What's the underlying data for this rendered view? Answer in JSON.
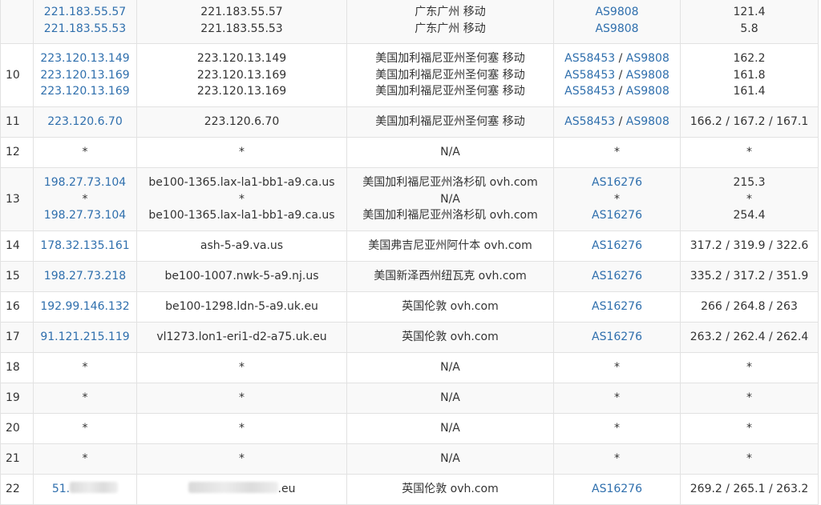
{
  "table": {
    "link_color": "#2f6fad",
    "rows": [
      {
        "hop": "",
        "ips": [
          "221.183.55.57",
          "221.183.55.53"
        ],
        "hosts": [
          "221.183.55.57",
          "221.183.55.53"
        ],
        "locs": [
          "广东广州 移动",
          "广东广州 移动"
        ],
        "asns": [
          [
            "AS9808"
          ],
          [
            "AS9808"
          ]
        ],
        "times": [
          "121.4",
          "5.8"
        ]
      },
      {
        "hop": "10",
        "ips": [
          "223.120.13.149",
          "223.120.13.169",
          "223.120.13.169"
        ],
        "hosts": [
          "223.120.13.149",
          "223.120.13.169",
          "223.120.13.169"
        ],
        "locs": [
          "美国加利福尼亚州圣何塞 移动",
          "美国加利福尼亚州圣何塞 移动",
          "美国加利福尼亚州圣何塞 移动"
        ],
        "asns": [
          [
            "AS58453",
            "AS9808"
          ],
          [
            "AS58453",
            "AS9808"
          ],
          [
            "AS58453",
            "AS9808"
          ]
        ],
        "times": [
          "162.2",
          "161.8",
          "161.4"
        ]
      },
      {
        "hop": "11",
        "ips": [
          "223.120.6.70"
        ],
        "hosts": [
          "223.120.6.70"
        ],
        "locs": [
          "美国加利福尼亚州圣何塞 移动"
        ],
        "asns": [
          [
            "AS58453",
            "AS9808"
          ]
        ],
        "times": [
          "166.2 / 167.2 / 167.1"
        ]
      },
      {
        "hop": "12",
        "ips": [
          "*"
        ],
        "hosts": [
          "*"
        ],
        "locs": [
          "N/A"
        ],
        "asns": [
          [
            "*"
          ]
        ],
        "times": [
          "*"
        ]
      },
      {
        "hop": "13",
        "ips": [
          "198.27.73.104",
          "*",
          "198.27.73.104"
        ],
        "hosts": [
          "be100-1365.lax-la1-bb1-a9.ca.us",
          "*",
          "be100-1365.lax-la1-bb1-a9.ca.us"
        ],
        "locs": [
          "美国加利福尼亚州洛杉矶 ovh.com",
          "N/A",
          "美国加利福尼亚州洛杉矶 ovh.com"
        ],
        "asns": [
          [
            "AS16276"
          ],
          [
            "*"
          ],
          [
            "AS16276"
          ]
        ],
        "times": [
          "215.3",
          "*",
          "254.4"
        ]
      },
      {
        "hop": "14",
        "ips": [
          "178.32.135.161"
        ],
        "hosts": [
          "ash-5-a9.va.us"
        ],
        "locs": [
          "美国弗吉尼亚州阿什本 ovh.com"
        ],
        "asns": [
          [
            "AS16276"
          ]
        ],
        "times": [
          "317.2 / 319.9 / 322.6"
        ]
      },
      {
        "hop": "15",
        "ips": [
          "198.27.73.218"
        ],
        "hosts": [
          "be100-1007.nwk-5-a9.nj.us"
        ],
        "locs": [
          "美国新泽西州纽瓦克 ovh.com"
        ],
        "asns": [
          [
            "AS16276"
          ]
        ],
        "times": [
          "335.2 / 317.2 / 351.9"
        ]
      },
      {
        "hop": "16",
        "ips": [
          "192.99.146.132"
        ],
        "hosts": [
          "be100-1298.ldn-5-a9.uk.eu"
        ],
        "locs": [
          "英国伦敦 ovh.com"
        ],
        "asns": [
          [
            "AS16276"
          ]
        ],
        "times": [
          "266 / 264.8 / 263"
        ]
      },
      {
        "hop": "17",
        "ips": [
          "91.121.215.119"
        ],
        "hosts": [
          "vl1273.lon1-eri1-d2-a75.uk.eu"
        ],
        "locs": [
          "英国伦敦 ovh.com"
        ],
        "asns": [
          [
            "AS16276"
          ]
        ],
        "times": [
          "263.2 / 262.4 / 262.4"
        ]
      },
      {
        "hop": "18",
        "ips": [
          "*"
        ],
        "hosts": [
          "*"
        ],
        "locs": [
          "N/A"
        ],
        "asns": [
          [
            "*"
          ]
        ],
        "times": [
          "*"
        ]
      },
      {
        "hop": "19",
        "ips": [
          "*"
        ],
        "hosts": [
          "*"
        ],
        "locs": [
          "N/A"
        ],
        "asns": [
          [
            "*"
          ]
        ],
        "times": [
          "*"
        ]
      },
      {
        "hop": "20",
        "ips": [
          "*"
        ],
        "hosts": [
          "*"
        ],
        "locs": [
          "N/A"
        ],
        "asns": [
          [
            "*"
          ]
        ],
        "times": [
          "*"
        ]
      },
      {
        "hop": "21",
        "ips": [
          "*"
        ],
        "hosts": [
          "*"
        ],
        "locs": [
          "N/A"
        ],
        "asns": [
          [
            "*"
          ]
        ],
        "times": [
          "*"
        ]
      },
      {
        "hop": "22",
        "ips": [
          "51."
        ],
        "ip_blurred": true,
        "hosts": [
          ".eu"
        ],
        "host_blurred": true,
        "locs": [
          "英国伦敦 ovh.com"
        ],
        "asns": [
          [
            "AS16276"
          ]
        ],
        "times": [
          "269.2 / 265.1 / 263.2"
        ]
      }
    ]
  }
}
